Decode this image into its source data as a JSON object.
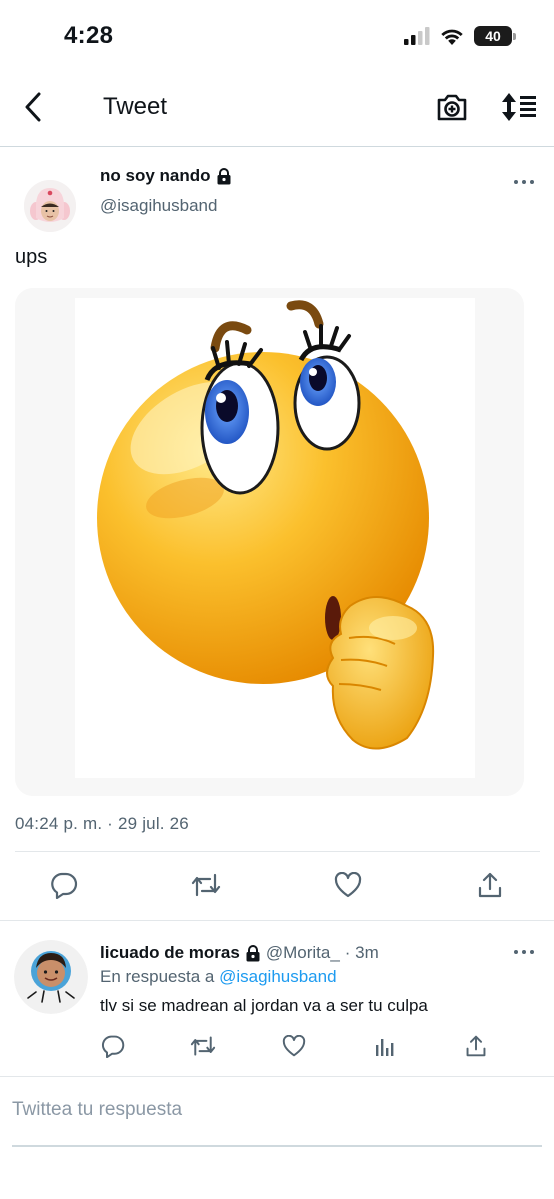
{
  "status_bar": {
    "time": "4:28",
    "battery": "40",
    "icons": [
      "cellular-signal-icon",
      "wifi-icon",
      "battery-icon"
    ]
  },
  "nav": {
    "title": "Tweet",
    "icons": [
      "back-arrow-icon",
      "camera-plus-icon",
      "sort-icon"
    ]
  },
  "tweet": {
    "author_name": "no soy nando",
    "author_handle": "@isagihusband",
    "text": "ups",
    "timestamp": "04:24 p. m. · 29 jul. 26",
    "media": "thinking-face-emoji-image",
    "actions": [
      "reply-icon",
      "retweet-icon",
      "like-icon",
      "share-icon"
    ]
  },
  "reply": {
    "author_name": "licuado de moras",
    "author_handle": "@Morita_",
    "time": "· 3m",
    "reply_prefix": "En respuesta a",
    "reply_to": "@isagihusband",
    "text": "tlv si se madrean al jordan va a ser tu culpa",
    "actions": [
      "reply-icon",
      "retweet-icon",
      "like-icon",
      "analytics-icon",
      "share-icon"
    ]
  },
  "compose": {
    "placeholder": "Twittea tu respuesta"
  },
  "colors": {
    "link": "#1d9bf0",
    "secondary_text": "#536471",
    "primary_text": "#0f1419"
  }
}
